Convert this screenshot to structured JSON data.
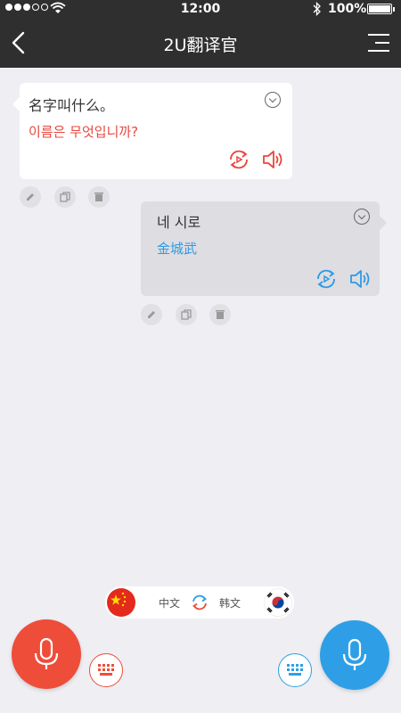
{
  "status_bar": {
    "time": "12:00",
    "battery": "100%",
    "icons": [
      "signal-dots-icon",
      "wifi-icon",
      "bluetooth-icon",
      "battery-icon"
    ]
  },
  "nav": {
    "title": "2U翻译官",
    "back_icon": "chevron-left-icon",
    "menu_icon": "menu-icon"
  },
  "messages": [
    {
      "side": "left",
      "source": "名字叫什么。",
      "translation": "이름은 무엇입니까?",
      "translation_color": "#e8473e",
      "icons": [
        "expand-icon",
        "replay-icon",
        "speaker-icon",
        "edit-icon",
        "copy-icon",
        "delete-icon"
      ]
    },
    {
      "side": "right",
      "source": "네 시로",
      "translation": "金城武",
      "translation_color": "#2e9be4",
      "icons": [
        "expand-icon",
        "replay-icon",
        "speaker-icon",
        "edit-icon",
        "copy-icon",
        "delete-icon"
      ]
    }
  ],
  "language_bar": {
    "left_lang": "中文",
    "right_lang": "韩文",
    "left_flag": "china-flag-icon",
    "right_flag": "korea-flag-icon",
    "swap_icon": "swap-icon"
  },
  "bottom": {
    "left_mic_color": "#ee4d3a",
    "right_mic_color": "#2e9fe6",
    "icons": [
      "microphone-icon",
      "keyboard-icon"
    ]
  }
}
